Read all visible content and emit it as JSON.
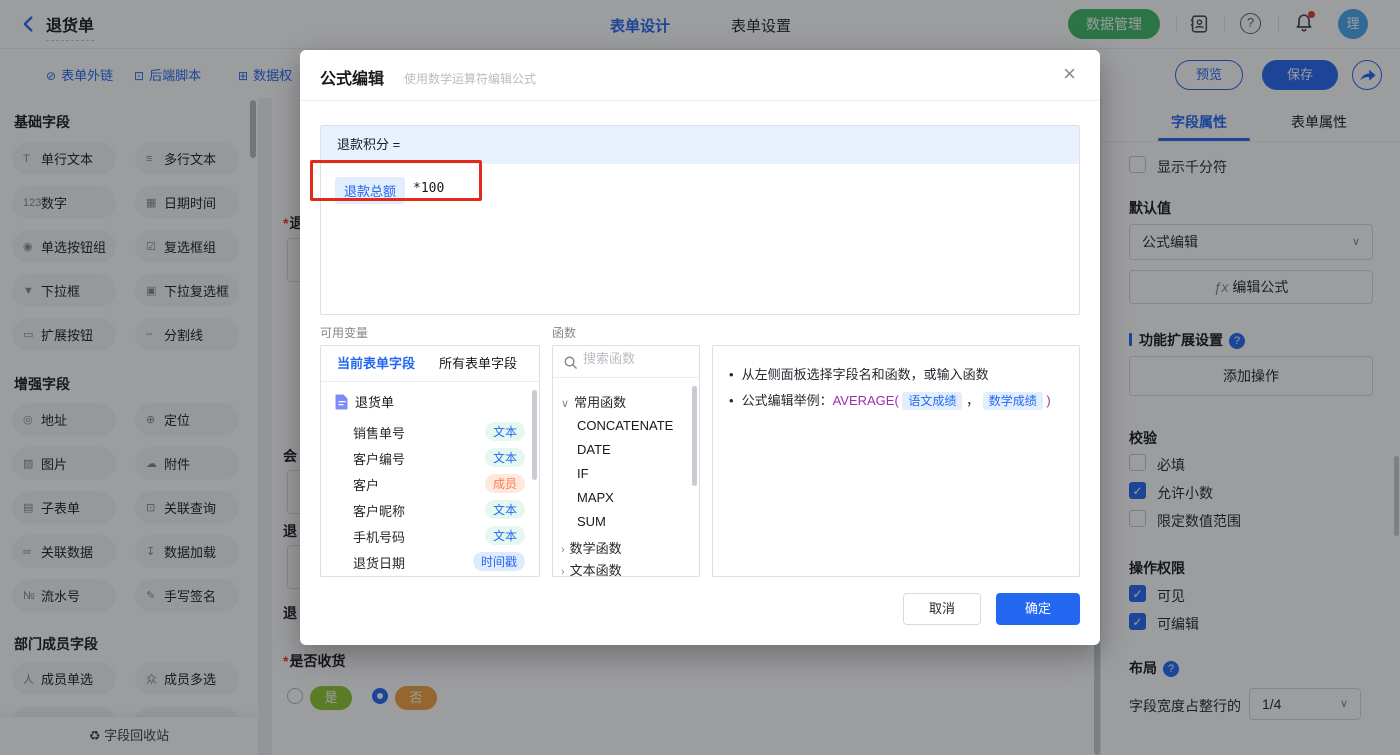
{
  "colors": {
    "accent": "#2468f2",
    "green_button": "#3fb865",
    "annotation_red": "#e22a1a",
    "yes_green": "#8fc62f",
    "no_orange": "#efa23e"
  },
  "topbar": {
    "title": "退货单",
    "tab_design": "表单设计",
    "tab_settings": "表单设置",
    "data_manage": "数据管理",
    "help": "?",
    "avatar": "理"
  },
  "toolbar": {
    "link_external": "表单外链",
    "icon_external": "⊘",
    "link_script": "后端脚本",
    "icon_script": "⊡",
    "link_perm": "数据权",
    "icon_perm": "⊞",
    "preview": "预览",
    "save": "保存"
  },
  "sidebar": {
    "sections": [
      {
        "title": "基础字段",
        "items": [
          {
            "icon": "T",
            "label": "单行文本"
          },
          {
            "icon": "≡",
            "label": "多行文本"
          },
          {
            "icon": "123",
            "label": "数字"
          },
          {
            "icon": "▦",
            "label": "日期时间"
          },
          {
            "icon": "◉",
            "label": "单选按钮组"
          },
          {
            "icon": "☑",
            "label": "复选框组"
          },
          {
            "icon": "▼",
            "label": "下拉框"
          },
          {
            "icon": "▣",
            "label": "下拉复选框"
          },
          {
            "icon": "▭",
            "label": "扩展按钮"
          },
          {
            "icon": "┄",
            "label": "分割线"
          }
        ]
      },
      {
        "title": "增强字段",
        "items": [
          {
            "icon": "◎",
            "label": "地址"
          },
          {
            "icon": "⊕",
            "label": "定位"
          },
          {
            "icon": "▨",
            "label": "图片"
          },
          {
            "icon": "☁",
            "label": "附件"
          },
          {
            "icon": "▤",
            "label": "子表单"
          },
          {
            "icon": "⊡",
            "label": "关联查询"
          },
          {
            "icon": "∞",
            "label": "关联数据"
          },
          {
            "icon": "↧",
            "label": "数据加载"
          },
          {
            "icon": "№",
            "label": "流水号"
          },
          {
            "icon": "✎",
            "label": "手写签名"
          }
        ]
      },
      {
        "title": "部门成员字段",
        "items": [
          {
            "icon": "人",
            "label": "成员单选"
          },
          {
            "icon": "众",
            "label": "成员多选"
          }
        ]
      }
    ],
    "recycle_icon": "♻",
    "recycle": "字段回收站"
  },
  "canvas": {
    "asterisk": "*",
    "frag1": "退",
    "frag2": "会",
    "frag3": "退",
    "frag4": "退",
    "receive": {
      "label": "是否收货",
      "yes": "是",
      "no": "否"
    }
  },
  "modal": {
    "title": "公式编辑",
    "subtitle": "使用数学运算符编辑公式",
    "close": "×",
    "formula": {
      "target": "退款积分 =",
      "chip": "退款总额",
      "rest": "*100"
    },
    "variables": {
      "label": "可用变量",
      "tab_current": "当前表单字段",
      "tab_all": "所有表单字段",
      "root": "退货单",
      "fields": [
        {
          "name": "销售单号",
          "type": "文本"
        },
        {
          "name": "客户编号",
          "type": "文本"
        },
        {
          "name": "客户",
          "type": "成员"
        },
        {
          "name": "客户昵称",
          "type": "文本"
        },
        {
          "name": "手机号码",
          "type": "文本"
        },
        {
          "name": "退货日期",
          "type": "时间戳"
        }
      ]
    },
    "functions": {
      "label": "函数",
      "search_placeholder": "搜索函数",
      "caret_open": "∨",
      "caret_closed": "›",
      "group_common": "常用函数",
      "items": [
        "CONCATENATE",
        "DATE",
        "IF",
        "MAPX",
        "SUM"
      ],
      "group_math": "数学函数",
      "group_text": "文本函数"
    },
    "tips": {
      "bullet": "•",
      "line1": "从左侧面板选择字段名和函数，或输入函数",
      "line2_prefix": "公式编辑举例：",
      "fn_open": "AVERAGE(",
      "chip1": "语文成绩",
      "comma": "，",
      "chip2": "数学成绩",
      "fn_close": ")"
    },
    "cancel": "取消",
    "confirm": "确定"
  },
  "properties": {
    "tab_field": "字段属性",
    "tab_form": "表单属性",
    "thousand": "显示千分符",
    "default_label": "默认值",
    "default_value": "公式编辑",
    "chevron": "∨",
    "fx": "ƒx",
    "formula_btn": "编辑公式",
    "ext_title": "功能扩展设置",
    "qmark": "?",
    "add_action": "添加操作",
    "validate_title": "校验",
    "required": "必填",
    "decimal": "允许小数",
    "range": "限定数值范围",
    "perm_title": "操作权限",
    "visible": "可见",
    "editable": "可编辑",
    "layout_title": "布局",
    "width_label": "字段宽度占整行的",
    "width_value": "1/4",
    "check": "✓"
  }
}
